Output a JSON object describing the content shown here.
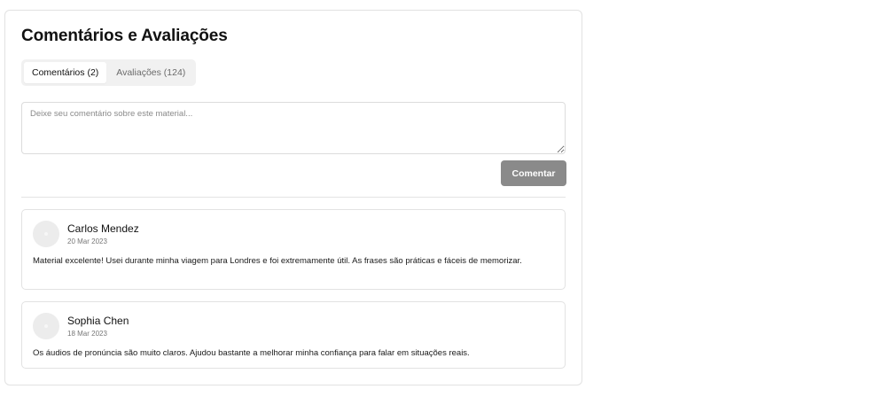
{
  "section": {
    "title": "Comentários e Avaliações"
  },
  "tabs": [
    {
      "label": "Comentários (2)",
      "active": true
    },
    {
      "label": "Avaliações (124)",
      "active": false
    }
  ],
  "composer": {
    "placeholder": "Deixe seu comentário sobre este material...",
    "value": "",
    "submit_label": "Comentar"
  },
  "comments": [
    {
      "author": "Carlos Mendez",
      "date": "20 Mar 2023",
      "text": "Material excelente! Usei durante minha viagem para Londres e foi extremamente útil. As frases são práticas e fáceis de memorizar.",
      "avatar_icon": "user-avatar-icon"
    },
    {
      "author": "Sophia Chen",
      "date": "18 Mar 2023",
      "text": "Os áudios de pronúncia são muito claros. Ajudou bastante a melhorar minha confiança para falar em situações reais.",
      "avatar_icon": "user-avatar-icon"
    }
  ],
  "colors": {
    "submit_disabled": "#8a8a8a",
    "tab_track": "#f1f1f1",
    "border": "#e2e2e2"
  }
}
